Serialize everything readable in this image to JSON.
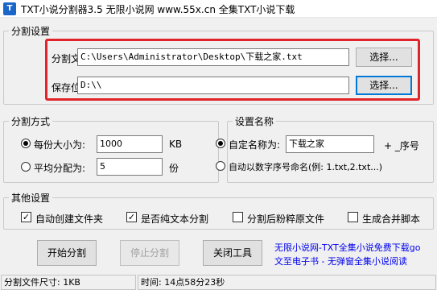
{
  "window": {
    "icon_text": "T",
    "title": "TXT小说分割器3.5  无限小说网 www.55x.cn 全集TXT小说下载"
  },
  "split_settings": {
    "legend": "分割设置",
    "file_label": "分割文件:",
    "file_value": "C:\\Users\\Administrator\\Desktop\\下载之家.txt",
    "browse_file": "选择...",
    "save_label": "保存位置:",
    "save_value": "D:\\\\",
    "browse_save": "选择..."
  },
  "split_mode": {
    "legend": "分割方式",
    "option_size_label": "每份大小为:",
    "size_value": "1000",
    "size_unit": "KB",
    "option_parts_label": "平均分配为:",
    "parts_value": "5",
    "parts_unit": "份",
    "selected": "size"
  },
  "name_settings": {
    "legend": "设置名称",
    "option_custom_label": "自定名称为:",
    "custom_value": "下载之家",
    "custom_suffix": "+ _序号",
    "option_number_label": "自动以数字序号命名(例: 1.txt,2.txt...)",
    "selected": "custom"
  },
  "other_settings": {
    "legend": "其他设置",
    "auto_folder": {
      "label": "自动创建文件夹",
      "checked": true
    },
    "plain_text": {
      "label": "是否纯文本分割",
      "checked": true
    },
    "shred_original": {
      "label": "分割后粉粹原文件",
      "checked": false
    },
    "merge_script": {
      "label": "生成合并脚本",
      "checked": false
    }
  },
  "actions": {
    "start": "开始分割",
    "stop": "停止分割",
    "close": "关闭工具"
  },
  "promo": {
    "line1": "无限小说网-TXT全集小说免费下载go",
    "line2": "文至电子书 - 无弹窗全集小说阅读"
  },
  "status": {
    "file_size": "分割文件尺寸: 1KB",
    "time": "时间: 14点58分23秒"
  },
  "colors": {
    "highlight_border": "#e0242a",
    "link": "#0000ee",
    "focus": "#0078d7"
  }
}
